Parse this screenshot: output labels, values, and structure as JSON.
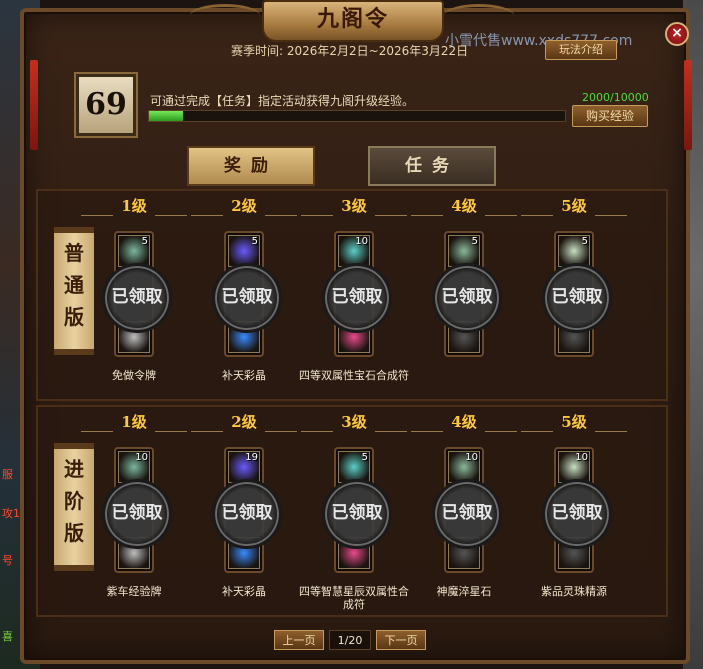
{
  "window": {
    "title": "九阁令",
    "close_symbol": "×"
  },
  "header": {
    "season_label": "赛季时间: 2026年2月2日~2026年3月22日",
    "watermark": "小雪代售www.xxds777.com",
    "guide_button": "玩法介绍"
  },
  "progress": {
    "level": "69",
    "description": "可通过完成【任务】指定活动获得九阁升级经验。",
    "exp_text": "2000/10000",
    "exp_fraction": 0.2,
    "buy_button": "购买经验"
  },
  "tabs": [
    {
      "label": "奖励"
    },
    {
      "label": "任务"
    }
  ],
  "tracks": [
    {
      "label": "普通版",
      "chars": [
        "普",
        "通",
        "版"
      ],
      "tiers": [
        {
          "level": "1级",
          "top_count": "5",
          "claimed": "已领取",
          "name": "免做令牌"
        },
        {
          "level": "2级",
          "top_count": "5",
          "claimed": "已领取",
          "name": "补天彩晶"
        },
        {
          "level": "3级",
          "top_count": "10",
          "claimed": "已领取",
          "name": "四等双属性宝石合成符"
        },
        {
          "level": "4级",
          "top_count": "5",
          "claimed": "已领取",
          "name": ""
        },
        {
          "level": "5级",
          "top_count": "5",
          "claimed": "已领取",
          "name": ""
        }
      ]
    },
    {
      "label": "进阶版",
      "chars": [
        "进",
        "阶",
        "版"
      ],
      "tiers": [
        {
          "level": "1级",
          "top_count": "10",
          "claimed": "已领取",
          "name": "紫车经验牌"
        },
        {
          "level": "2级",
          "top_count": "19",
          "claimed": "已领取",
          "name": "补天彩晶"
        },
        {
          "level": "3级",
          "top_count": "5",
          "claimed": "已领取",
          "name": "四等智慧星辰双属性合成符"
        },
        {
          "level": "4级",
          "top_count": "10",
          "claimed": "已领取",
          "name": "神魔淬星石"
        },
        {
          "level": "5级",
          "top_count": "10",
          "claimed": "已领取",
          "name": "紫品灵珠精源"
        }
      ]
    }
  ],
  "pager": {
    "prev": "上一页",
    "page": "1/20",
    "next": "下一页"
  },
  "left_edge_text": [
    "服",
    "攻1",
    "号",
    "喜"
  ],
  "colors": {
    "level_gold": "#ffc83a",
    "exp_green": "#4cdb3a",
    "close_red": "#c9282a"
  }
}
